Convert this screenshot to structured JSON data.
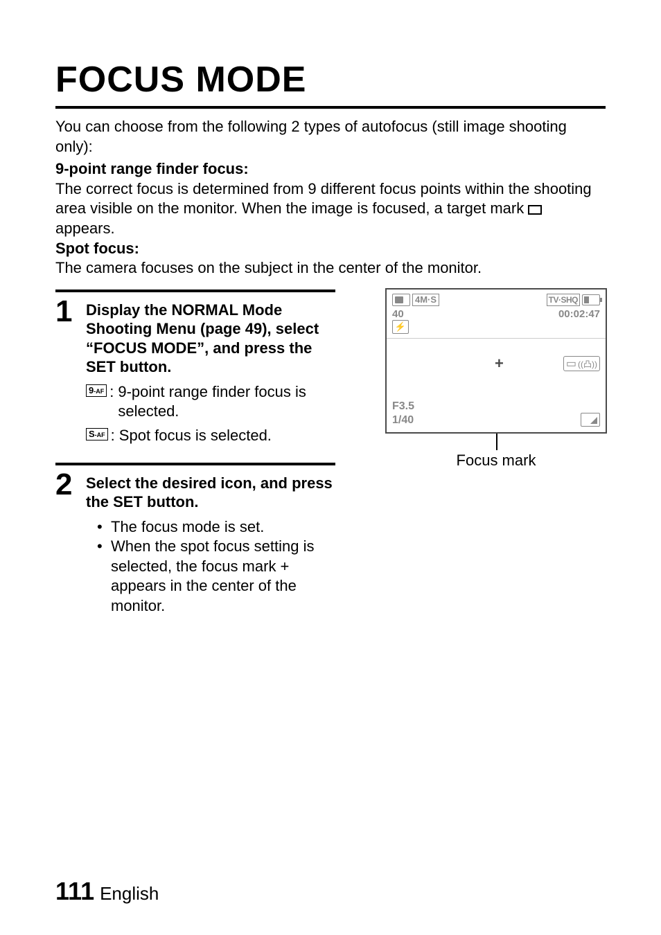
{
  "title": "FOCUS MODE",
  "intro": "You can choose from the following 2 types of autofocus (still image shooting only):",
  "mode1": {
    "name": "9-point range finder focus:",
    "desc_before": "The correct focus is determined from 9 different focus points within the shooting area visible on the monitor. When the image is focused, a target mark ",
    "desc_after": " appears."
  },
  "mode2": {
    "name": "Spot focus:",
    "desc": "The camera focuses on the subject in the center of the monitor."
  },
  "steps": {
    "step1": {
      "num": "1",
      "title": "Display the NORMAL Mode Shooting Menu (page 49), select “FOCUS MODE”, and press the SET button.",
      "icon1": {
        "prefix": "9",
        "sub": "-AF",
        "desc": "9-point range finder focus is selected."
      },
      "icon2": {
        "prefix": "S",
        "sub": "-AF",
        "desc": "Spot focus is selected."
      }
    },
    "step2": {
      "num": "2",
      "title": "Select the desired icon, and press the SET button.",
      "bullet1": "The focus mode is set.",
      "bullet2": "When the spot focus setting is selected, the focus mark + appears in the center of the monitor."
    }
  },
  "screen": {
    "img_mode": "4M·S",
    "shots": "40",
    "tvshq": "TV·SHQ",
    "time": "00:02:47",
    "fstop": "F3.5",
    "shutter": "1/40",
    "plus": "+",
    "label": "Focus mark"
  },
  "footer": {
    "page": "111",
    "lang": "English"
  }
}
